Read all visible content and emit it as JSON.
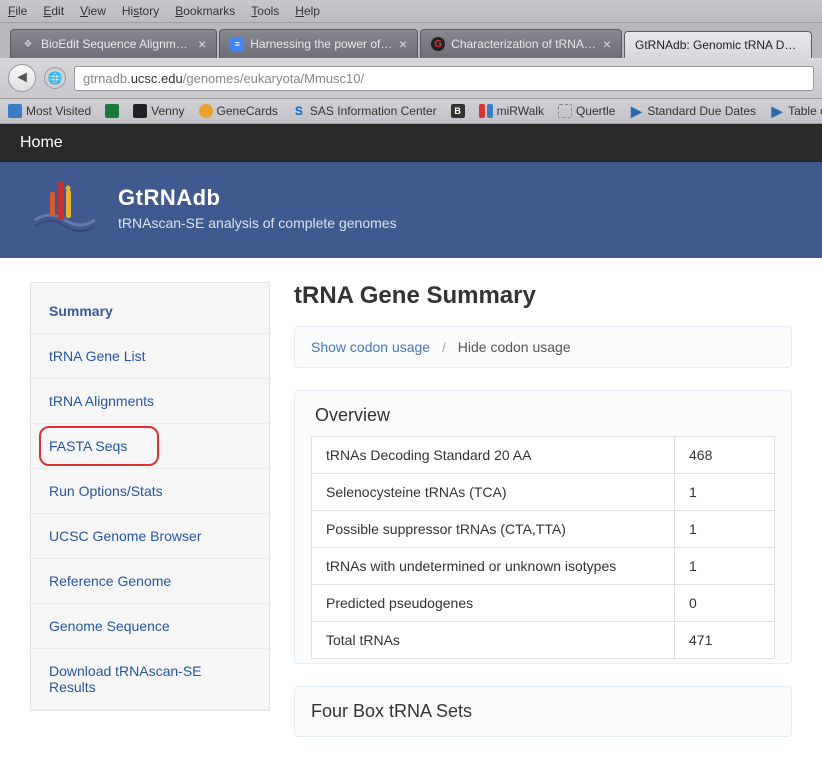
{
  "menubar": [
    "File",
    "Edit",
    "View",
    "History",
    "Bookmarks",
    "Tools",
    "Help"
  ],
  "tabs": [
    {
      "label": "BioEdit Sequence Alignment E...",
      "icon": "apple"
    },
    {
      "label": "Harnessing the power of Exc...",
      "icon": "gdoc"
    },
    {
      "label": "Characterization of tRNA-deri...",
      "icon": "g"
    },
    {
      "label": "GtRNAdb: Genomic tRNA Databas",
      "icon": "",
      "active": true
    }
  ],
  "url": {
    "prefix": "gtrnadb.",
    "host": "ucsc.edu",
    "path": "/genomes/eukaryota/Mmusc10/"
  },
  "bookmarks": [
    {
      "label": "Most Visited",
      "icon": "mv"
    },
    {
      "label": "",
      "icon": "venny1"
    },
    {
      "label": "Venny",
      "icon": "venny2"
    },
    {
      "label": "GeneCards",
      "icon": "gc"
    },
    {
      "label": "SAS Information Center",
      "icon": "sas",
      "glyph": "S"
    },
    {
      "label": "",
      "icon": "b",
      "glyph": "B"
    },
    {
      "label": "miRWalk",
      "icon": "mir"
    },
    {
      "label": "Quertle",
      "icon": "q"
    },
    {
      "label": "Standard Due Dates",
      "icon": "sd",
      "glyph": "▶"
    },
    {
      "label": "Table of Page Limits",
      "icon": "sd",
      "glyph": "▶"
    }
  ],
  "home_label": "Home",
  "banner": {
    "title": "GtRNAdb",
    "subtitle": "tRNAscan-SE analysis of complete genomes"
  },
  "sidebar": {
    "sections": [
      [
        "Summary",
        "tRNA Gene List",
        "tRNA Alignments",
        "FASTA Seqs",
        "Run Options/Stats"
      ],
      [
        "UCSC Genome Browser",
        "Reference Genome",
        "Genome Sequence"
      ],
      [
        "Download tRNAscan-SE Results"
      ]
    ],
    "highlighted_index": 3
  },
  "main": {
    "title": "tRNA Gene Summary",
    "codon": {
      "show": "Show codon usage",
      "hide": "Hide codon usage"
    },
    "overview_title": "Overview",
    "overview_rows": [
      {
        "label": "tRNAs Decoding Standard 20 AA",
        "value": "468"
      },
      {
        "label": "Selenocysteine tRNAs (TCA)",
        "value": "1"
      },
      {
        "label": "Possible suppressor tRNAs (CTA,TTA)",
        "value": "1"
      },
      {
        "label": "tRNAs with undetermined or unknown isotypes",
        "value": "1"
      },
      {
        "label": "Predicted pseudogenes",
        "value": "0"
      },
      {
        "label": "Total tRNAs",
        "value": "471"
      }
    ],
    "panel2_title": "Four Box tRNA Sets"
  }
}
